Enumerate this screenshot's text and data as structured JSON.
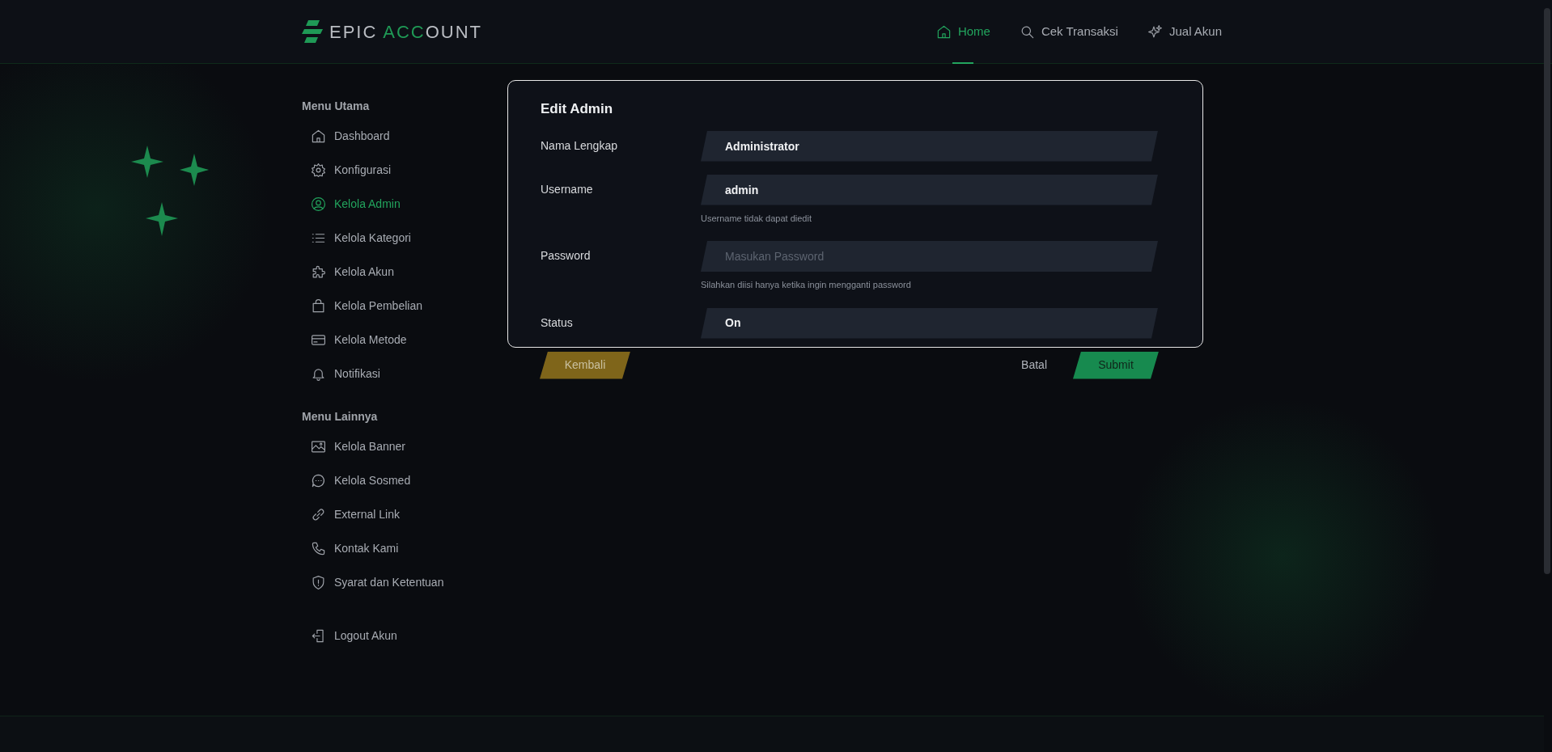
{
  "logo": {
    "parts": [
      {
        "text": "EPIC ",
        "accent": false
      },
      {
        "text": "ACC",
        "accent": true
      },
      {
        "text": "OUNT",
        "accent": false
      }
    ]
  },
  "nav": [
    {
      "label": "Home",
      "selected": true
    },
    {
      "label": "Cek Transaksi",
      "selected": false
    },
    {
      "label": "Jual Akun",
      "selected": false
    }
  ],
  "sidebar": {
    "sections": [
      {
        "title": "Menu Utama",
        "items": [
          {
            "label": "Dashboard",
            "selected": false
          },
          {
            "label": "Konfigurasi",
            "selected": false
          },
          {
            "label": "Kelola Admin",
            "selected": true
          },
          {
            "label": "Kelola Kategori",
            "selected": false
          },
          {
            "label": "Kelola Akun",
            "selected": false
          },
          {
            "label": "Kelola Pembelian",
            "selected": false
          },
          {
            "label": "Kelola Metode",
            "selected": false
          },
          {
            "label": "Notifikasi",
            "selected": false
          }
        ]
      },
      {
        "title": "Menu Lainnya",
        "items": [
          {
            "label": "Kelola Banner",
            "selected": false
          },
          {
            "label": "Kelola Sosmed",
            "selected": false
          },
          {
            "label": "External Link",
            "selected": false
          },
          {
            "label": "Kontak Kami",
            "selected": false
          },
          {
            "label": "Syarat dan Ketentuan",
            "selected": false
          }
        ]
      }
    ],
    "logout": {
      "label": "Logout Akun"
    }
  },
  "form": {
    "title": "Edit Admin",
    "fields": [
      {
        "label": "Nama Lengkap",
        "kind": "text",
        "value": "Administrator"
      },
      {
        "label": "Username",
        "kind": "text",
        "value": "admin",
        "help": "Username tidak dapat diedit"
      },
      {
        "label": "Password",
        "kind": "password",
        "placeholder": "Masukan Password",
        "help": "Silahkan diisi hanya ketika ingin mengganti password"
      },
      {
        "label": "Status",
        "kind": "select",
        "value": "On"
      }
    ],
    "back_button": "Kembali",
    "cancel_button": "Batal",
    "submit_button": "Submit"
  }
}
